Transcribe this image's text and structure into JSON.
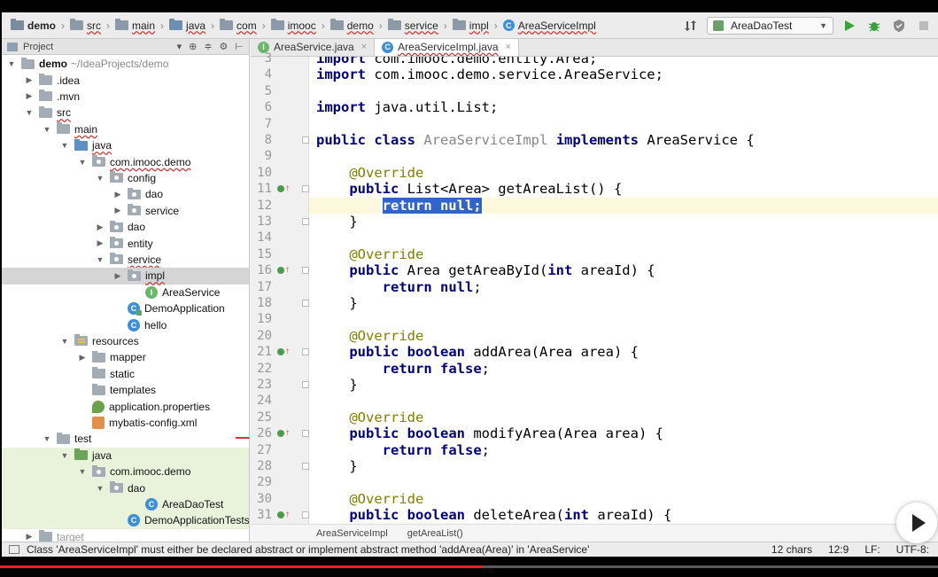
{
  "breadcrumbs": [
    "demo",
    "src",
    "main",
    "java",
    "com",
    "imooc",
    "demo",
    "service",
    "impl",
    "AreaServiceImpl"
  ],
  "run_config": {
    "label": "AreaDaoTest"
  },
  "project_panel": {
    "title": "Project"
  },
  "tree": [
    {
      "label": "demo",
      "extra": "~/IdeaProjects/demo",
      "indent": 0,
      "twisty": "open",
      "icon": "folder",
      "bold": true
    },
    {
      "label": ".idea",
      "indent": 1,
      "twisty": "closed",
      "icon": "folder"
    },
    {
      "label": ".mvn",
      "indent": 1,
      "twisty": "closed",
      "icon": "folder"
    },
    {
      "label": "src",
      "indent": 1,
      "twisty": "open",
      "icon": "folder",
      "ul": true
    },
    {
      "label": "main",
      "indent": 2,
      "twisty": "open",
      "icon": "folder",
      "ul": true
    },
    {
      "label": "java",
      "indent": 3,
      "twisty": "open",
      "icon": "src",
      "ul": true
    },
    {
      "label": "com.imooc.demo",
      "indent": 4,
      "twisty": "open",
      "icon": "pkg",
      "ul": true
    },
    {
      "label": "config",
      "indent": 5,
      "twisty": "open",
      "icon": "pkg"
    },
    {
      "label": "dao",
      "indent": 6,
      "twisty": "closed",
      "icon": "pkg"
    },
    {
      "label": "service",
      "indent": 6,
      "twisty": "closed",
      "icon": "pkg"
    },
    {
      "label": "dao",
      "indent": 5,
      "twisty": "closed",
      "icon": "pkg"
    },
    {
      "label": "entity",
      "indent": 5,
      "twisty": "closed",
      "icon": "pkg"
    },
    {
      "label": "service",
      "indent": 5,
      "twisty": "open",
      "icon": "pkg",
      "ul": true
    },
    {
      "label": "impl",
      "indent": 6,
      "twisty": "closed",
      "icon": "pkg",
      "ul": true,
      "selected": true
    },
    {
      "label": "AreaService",
      "indent": 7,
      "twisty": "",
      "icon": "iface"
    },
    {
      "label": "DemoApplication",
      "indent": 6,
      "twisty": "",
      "icon": "clsrun"
    },
    {
      "label": "hello",
      "indent": 6,
      "twisty": "",
      "icon": "cls"
    },
    {
      "label": "resources",
      "indent": 3,
      "twisty": "open",
      "icon": "res"
    },
    {
      "label": "mapper",
      "indent": 4,
      "twisty": "closed",
      "icon": "folder"
    },
    {
      "label": "static",
      "indent": 4,
      "twisty": "",
      "icon": "folder"
    },
    {
      "label": "templates",
      "indent": 4,
      "twisty": "",
      "icon": "folder"
    },
    {
      "label": "application.properties",
      "indent": 4,
      "twisty": "",
      "icon": "prop"
    },
    {
      "label": "mybatis-config.xml",
      "indent": 4,
      "twisty": "",
      "icon": "xml"
    },
    {
      "label": "test",
      "indent": 2,
      "twisty": "open",
      "icon": "folder"
    },
    {
      "label": "java",
      "indent": 3,
      "twisty": "open",
      "icon": "test",
      "green": true
    },
    {
      "label": "com.imooc.demo",
      "indent": 4,
      "twisty": "open",
      "icon": "pkg",
      "green": true
    },
    {
      "label": "dao",
      "indent": 5,
      "twisty": "open",
      "icon": "pkg",
      "green": true
    },
    {
      "label": "AreaDaoTest",
      "indent": 7,
      "twisty": "",
      "icon": "cls",
      "green": true
    },
    {
      "label": "DemoApplicationTests",
      "indent": 6,
      "twisty": "",
      "icon": "cls",
      "green": true
    },
    {
      "label": "target",
      "indent": 1,
      "twisty": "closed",
      "icon": "folder",
      "dim": true
    }
  ],
  "tabs": [
    {
      "label": "AreaService.java",
      "icon": "I",
      "active": false
    },
    {
      "label": "AreaServiceImpl.java",
      "icon": "C",
      "active": true
    }
  ],
  "code_lines": [
    {
      "n": "3",
      "src": "import com.imooc.demo.entity.Area;"
    },
    {
      "n": "4",
      "src": "import com.imooc.demo.service.AreaService;"
    },
    {
      "n": "5",
      "src": ""
    },
    {
      "n": "6",
      "src": "import java.util.List;"
    },
    {
      "n": "7",
      "src": ""
    },
    {
      "n": "8",
      "src": "public class AreaServiceImpl implements AreaService {"
    },
    {
      "n": "9",
      "src": ""
    },
    {
      "n": "10",
      "src": "    @Override"
    },
    {
      "n": "11",
      "src": "    public List<Area> getAreaList() {",
      "marker": true
    },
    {
      "n": "12",
      "src": "        return null;",
      "current": true,
      "selected": true
    },
    {
      "n": "13",
      "src": "    }"
    },
    {
      "n": "14",
      "src": ""
    },
    {
      "n": "15",
      "src": "    @Override"
    },
    {
      "n": "16",
      "src": "    public Area getAreaById(int areaId) {",
      "marker": true
    },
    {
      "n": "17",
      "src": "        return null;"
    },
    {
      "n": "18",
      "src": "    }"
    },
    {
      "n": "19",
      "src": ""
    },
    {
      "n": "20",
      "src": "    @Override"
    },
    {
      "n": "21",
      "src": "    public boolean addArea(Area area) {",
      "marker": true
    },
    {
      "n": "22",
      "src": "        return false;"
    },
    {
      "n": "23",
      "src": "    }"
    },
    {
      "n": "24",
      "src": ""
    },
    {
      "n": "25",
      "src": "    @Override"
    },
    {
      "n": "26",
      "src": "    public boolean modifyArea(Area area) {",
      "marker": true
    },
    {
      "n": "27",
      "src": "        return false;"
    },
    {
      "n": "28",
      "src": "    }"
    },
    {
      "n": "29",
      "src": ""
    },
    {
      "n": "30",
      "src": "    @Override"
    },
    {
      "n": "31",
      "src": "    public boolean deleteArea(int areaId) {",
      "marker": true
    }
  ],
  "editor_breadcrumbs": [
    "AreaServiceImpl",
    "getAreaList()"
  ],
  "status": {
    "message": "Class 'AreaServiceImpl' must either be declared abstract or implement abstract method 'addArea(Area)' in 'AreaService'",
    "chars": "12 chars",
    "position": "12:9",
    "line_sep": "LF:",
    "encoding": "UTF-8:"
  },
  "video_progress": 0.515,
  "icons": [
    "folder-icon",
    "class-icon",
    "run-icon",
    "debug-icon",
    "coverage-icon",
    "stop-icon",
    "play-icon"
  ]
}
